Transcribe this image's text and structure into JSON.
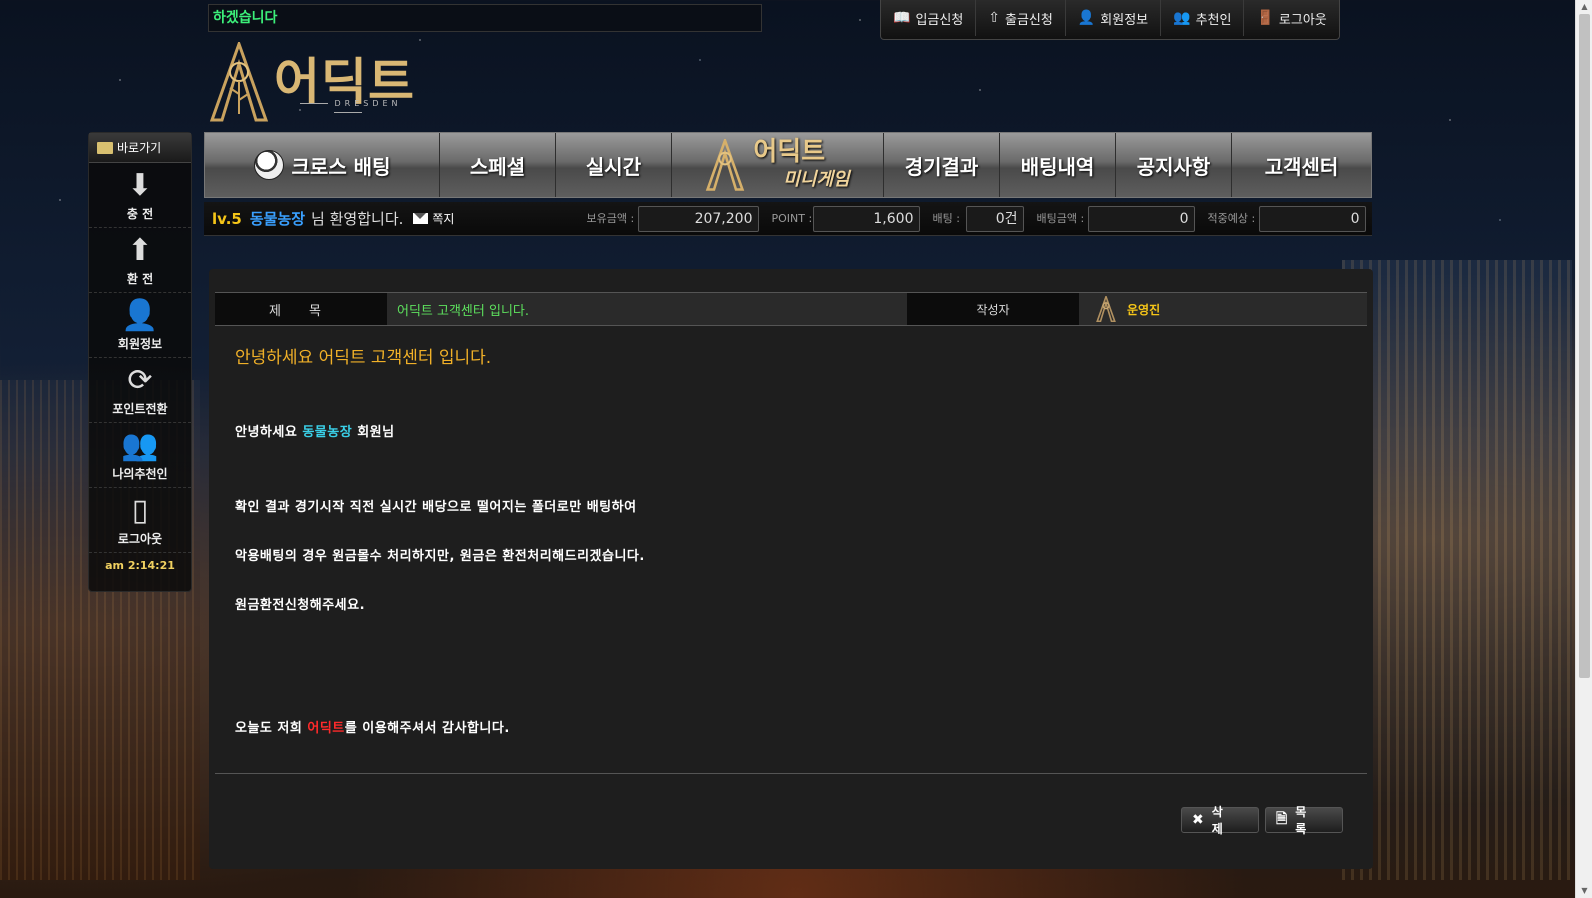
{
  "ticker": {
    "text": "하겠습니다"
  },
  "topnav": [
    {
      "label": "입금신청",
      "icon": "deposit-book-icon",
      "glyph": "📖"
    },
    {
      "label": "출금신청",
      "icon": "withdraw-upload-icon",
      "glyph": "⇧"
    },
    {
      "label": "회원정보",
      "icon": "user-icon",
      "glyph": "👤"
    },
    {
      "label": "추천인",
      "icon": "users-group-icon",
      "glyph": "👥"
    },
    {
      "label": "로그아웃",
      "icon": "door-icon",
      "glyph": "🚪"
    }
  ],
  "logo": {
    "name": "어딕트",
    "sub": "DRESDEN"
  },
  "mainmenu": {
    "cross": "크로스 배팅",
    "special": "스페셜",
    "live": "실시간",
    "mini_title": "어딕트",
    "mini_sub": "미니게임",
    "results": "경기결과",
    "history": "배팅내역",
    "notice": "공지사항",
    "support": "고객센터"
  },
  "userbar": {
    "level": "lv.5",
    "username": "동물농장",
    "welcome": "님 환영합니다.",
    "message_label": "쪽지",
    "balance_label": "보유금액 :",
    "balance": "207,200",
    "point_label": "POINT :",
    "point": "1,600",
    "bet_label": "배팅 :",
    "bet": "0건",
    "bet_amount_label": "배팅금액 :",
    "bet_amount": "0",
    "expected_label": "적중예상 :",
    "expected": "0"
  },
  "sidebar": {
    "title": "바로가기",
    "items": [
      {
        "label": "충 전",
        "icon": "charge-download-icon",
        "glyph": "⬇"
      },
      {
        "label": "환 전",
        "icon": "exchange-upload-icon",
        "glyph": "⬆"
      },
      {
        "label": "회원정보",
        "icon": "user-check-icon",
        "glyph": "👤"
      },
      {
        "label": "포인트전환",
        "icon": "refresh-icon",
        "glyph": "⟳"
      },
      {
        "label": "나의추천인",
        "icon": "users-group-icon",
        "glyph": "👥"
      },
      {
        "label": "로그아웃",
        "icon": "door-icon",
        "glyph": "▯"
      }
    ],
    "clock": "am 2:14:21"
  },
  "post": {
    "title_label": "제 목",
    "title": "어딕트 고객센터 입니다.",
    "author_label": "작성자",
    "author": "운영진",
    "heading": "안녕하세요 어딕트 고객센터 입니다.",
    "greeting_pre": "안녕하세요 ",
    "greeting_user": "동물농장",
    "greeting_post": " 회원님",
    "line1": "확인 결과 경기시작 직전 실시간 배당으로 떨어지는 폴더로만 배팅하여",
    "line2": "악용배팅의 경우 원금몰수 처리하지만, 원금은 환전처리해드리겠습니다.",
    "line3": "원금환전신청해주세요.",
    "closing_pre": "오늘도 저희 ",
    "closing_brand": "어딕트",
    "closing_post": "를 이용해주셔서 감사합니다."
  },
  "buttons": {
    "delete": "삭 제",
    "list": "목 록"
  }
}
